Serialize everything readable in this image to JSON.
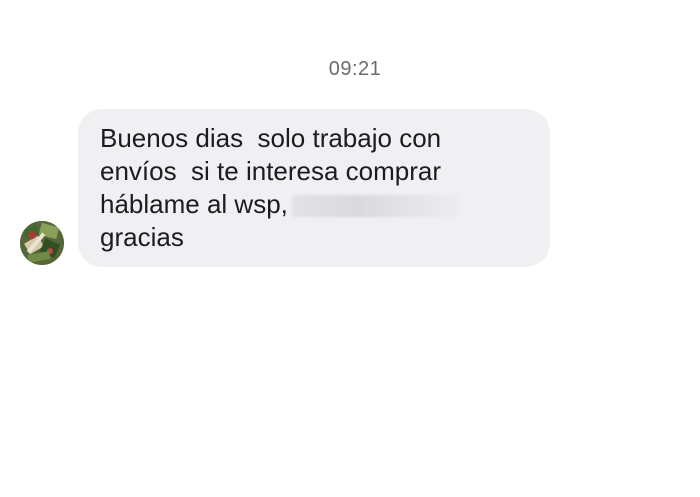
{
  "conversation": {
    "timestamp": "09:21",
    "message": {
      "lines": [
        "Buenos dias  solo trabajo con",
        "envíos  si te interesa comprar",
        "háblame al wsp,",
        "gracias"
      ]
    },
    "avatar": {
      "icon": "contact-avatar-icon",
      "colors": [
        "#3e6b2a",
        "#a63a3a",
        "#8aa05a",
        "#d8c9a8"
      ]
    }
  },
  "colors": {
    "bubble_bg": "#f0f0f3",
    "text": "#1c1c1e",
    "timestamp_text": "#6b6b70"
  }
}
